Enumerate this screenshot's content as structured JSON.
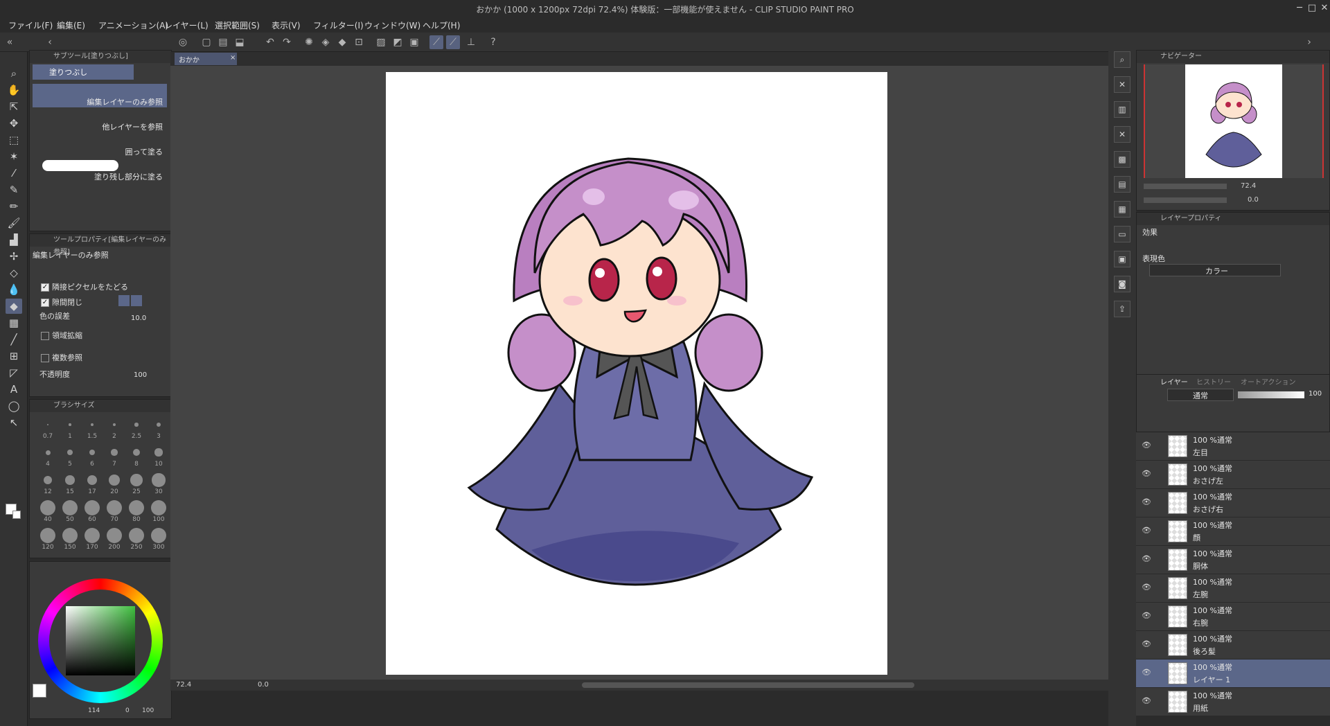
{
  "window": {
    "title": "おかか (1000 x 1200px 72dpi 72.4%) 体験版：一部機能が使えません - CLIP STUDIO PAINT PRO"
  },
  "menu": [
    "ファイル(F)",
    "編集(E)",
    "アニメーション(A)",
    "レイヤー(L)",
    "選択範囲(S)",
    "表示(V)",
    "フィルター(I)",
    "ウィンドウ(W)",
    "ヘルプ(H)"
  ],
  "canvas_tab": "おかか",
  "subtool_panel": {
    "title": "サブツール[塗りつぶし]",
    "group": "塗りつぶし",
    "items": [
      "編集レイヤーのみ参照",
      "他レイヤーを参照",
      "囲って塗る",
      "塗り残し部分に塗る"
    ]
  },
  "tool_property": {
    "title": "ツールプロパティ[編集レイヤーのみ参照]",
    "name": "編集レイヤーのみ参照",
    "follow_adjacent": "隣接ピクセルをたどる",
    "close_gap": "隙間閉じ",
    "tolerance_label": "色の誤差",
    "tolerance_value": "10.0",
    "area_scaling": "領域拡縮",
    "multi_ref": "複数参照",
    "opacity_label": "不透明度",
    "opacity_value": "100"
  },
  "brush_size": {
    "title": "ブラシサイズ",
    "sizes": [
      "0.7",
      "1",
      "1.5",
      "2",
      "2.5",
      "3",
      "4",
      "5",
      "6",
      "7",
      "8",
      "10",
      "12",
      "15",
      "17",
      "20",
      "25",
      "30",
      "40",
      "50",
      "60",
      "70",
      "80",
      "100",
      "120",
      "150",
      "170",
      "200",
      "250",
      "300"
    ]
  },
  "color_panel": {
    "hue_value": "114",
    "sat_value": "0",
    "val_value": "100",
    "current_color": "#3fbf3f"
  },
  "status": {
    "zoom": "72.4",
    "rotation": "0.0"
  },
  "navigator": {
    "title": "ナビゲーター",
    "zoom": "72.4",
    "rotation": "0.0"
  },
  "layer_property": {
    "title": "レイヤープロパティ",
    "effect_label": "効果",
    "expression_label": "表現色",
    "expression_value": "カラー"
  },
  "layer_panel": {
    "tabs": [
      "レイヤー",
      "ヒストリー",
      "オートアクション"
    ],
    "blend_mode": "通常",
    "opacity": "100",
    "layers": [
      {
        "mode": "100 %通常",
        "name": "左目"
      },
      {
        "mode": "100 %通常",
        "name": "おさげ左"
      },
      {
        "mode": "100 %通常",
        "name": "おさげ右"
      },
      {
        "mode": "100 %通常",
        "name": "顔"
      },
      {
        "mode": "100 %通常",
        "name": "胴体"
      },
      {
        "mode": "100 %通常",
        "name": "左腕"
      },
      {
        "mode": "100 %通常",
        "name": "右腕"
      },
      {
        "mode": "100 %通常",
        "name": "後ろ髪"
      },
      {
        "mode": "100 %通常",
        "name": "レイヤー 1"
      },
      {
        "mode": "100 %通常",
        "name": "用紙"
      }
    ]
  },
  "colors": {
    "accent": "#5b6789",
    "hair": "#c58fc9",
    "dress": "#5f5f9a",
    "ribbon": "#555555"
  }
}
